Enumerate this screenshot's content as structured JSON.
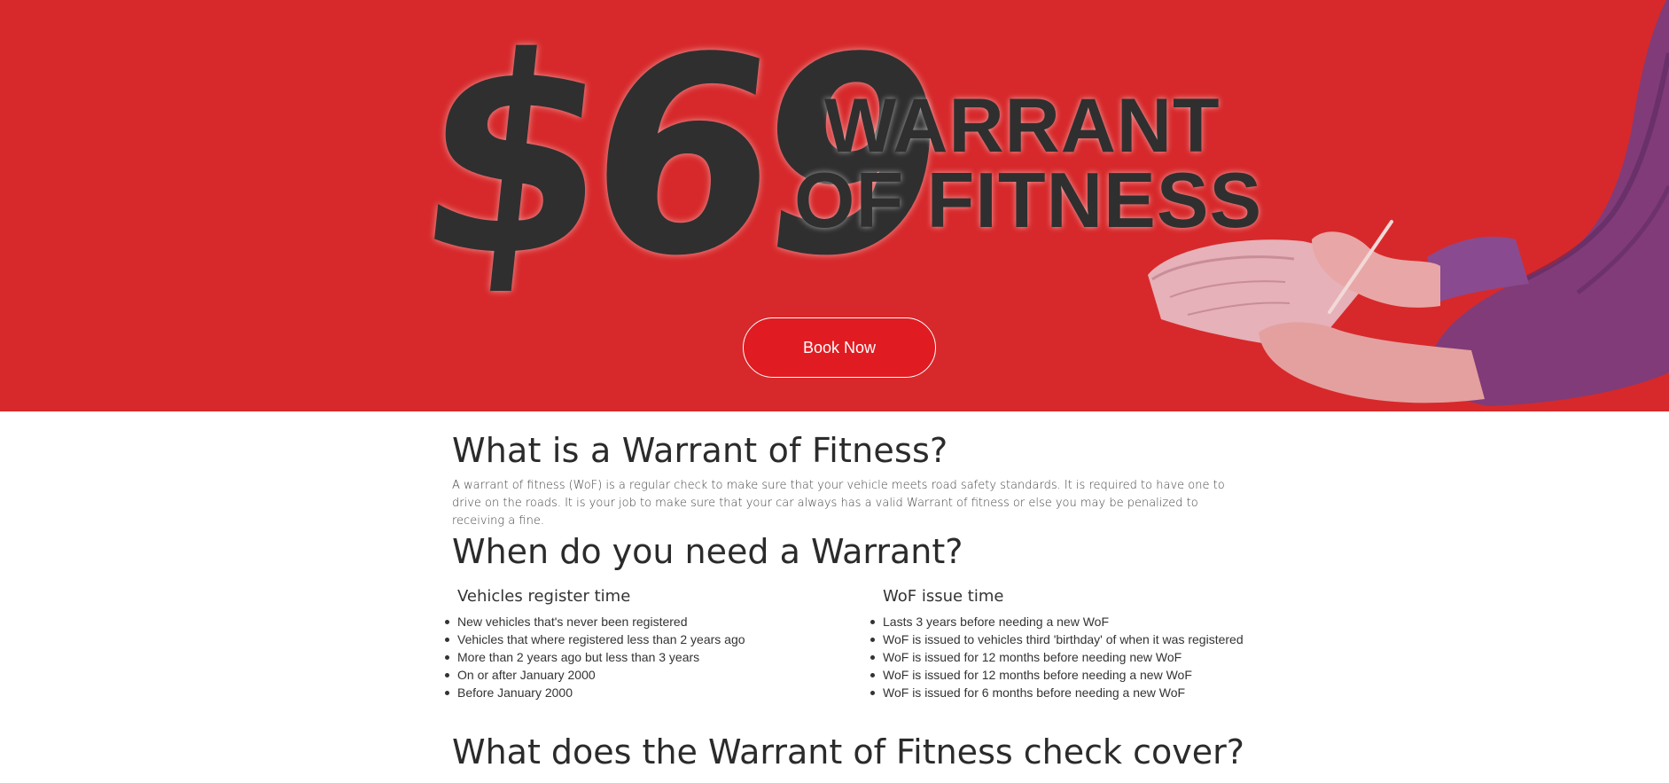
{
  "hero": {
    "price": "$69",
    "title_line1": "WARRANT",
    "title_line2": "OF FITNESS",
    "book_button": "Book Now",
    "background_color": "#d7292b",
    "button_color": "#e11b22"
  },
  "section_what": {
    "heading": "What is a Warrant of Fitness?",
    "body": "A warrant of fitness (WoF) is a regular check to make sure that your vehicle meets road safety standards. It is required to have one to drive on the roads. It is your job to make sure that your car always has a valid Warrant of fitness or else you may be penalized to receiving a fine."
  },
  "section_when": {
    "heading": "When do you need a Warrant?",
    "left": {
      "heading": "Vehicles register time",
      "items": [
        "New vehicles that's never been registered",
        "Vehicles that where registered less than 2 years ago",
        "More than 2 years ago but less than 3 years",
        "On or after January 2000",
        "Before January 2000"
      ]
    },
    "right": {
      "heading": "WoF issue time",
      "items": [
        "Lasts 3 years before needing a new WoF",
        "WoF is issued to vehicles third 'birthday' of when it was registered",
        "WoF is issued for 12 months before needing new WoF",
        "WoF is issued for 12 months before needing a new WoF",
        "WoF is issued for 6 months before needing a new WoF"
      ]
    }
  },
  "section_covers": {
    "heading": "What does the Warrant of Fitness check cover?"
  }
}
